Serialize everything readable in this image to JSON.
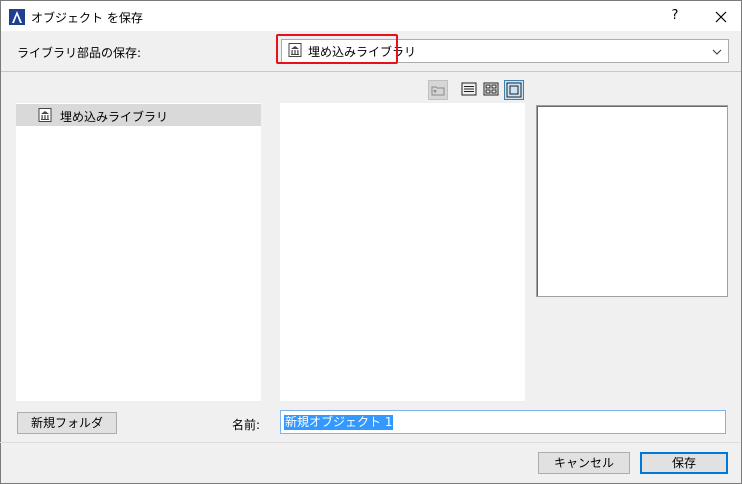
{
  "window": {
    "title": "オブジェクト を保存",
    "help_label": "?",
    "close_label": "✕"
  },
  "save_to": {
    "label": "ライブラリ部品の保存:",
    "selected_library": "埋め込みライブラリ",
    "highlight_color": "#e8111b"
  },
  "tree": {
    "items": [
      {
        "label": "埋め込みライブラリ",
        "selected": true
      }
    ]
  },
  "view_toolbar": {
    "buttons": [
      "parent-folder-icon",
      "list-view-icon",
      "grid-view-icon",
      "preview-view-icon"
    ],
    "active": "preview-view-icon"
  },
  "footer": {
    "new_folder_label": "新規フォルダ",
    "name_label": "名前:",
    "name_value": "新規オブジェクト 1",
    "cancel_label": "キャンセル",
    "save_label": "保存"
  }
}
